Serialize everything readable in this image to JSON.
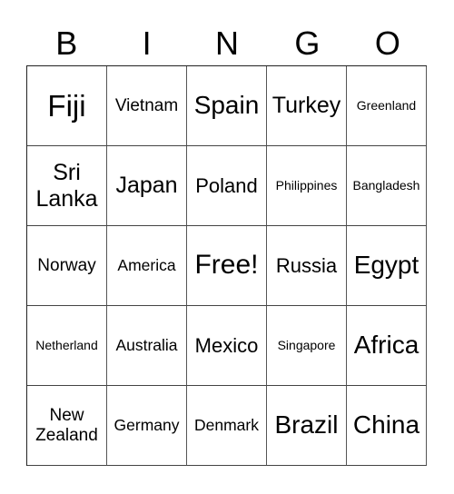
{
  "header": [
    "B",
    "I",
    "N",
    "G",
    "O"
  ],
  "cells": [
    [
      "Fiji",
      "Vietnam",
      "Spain",
      "Turkey",
      "Greenland"
    ],
    [
      "Sri Lanka",
      "Japan",
      "Poland",
      "Philippines",
      "Bangladesh"
    ],
    [
      "Norway",
      "America",
      "Free!",
      "Russia",
      "Egypt"
    ],
    [
      "Netherland",
      "Australia",
      "Mexico",
      "Singapore",
      "Africa"
    ],
    [
      "New Zealand",
      "Germany",
      "Denmark",
      "Brazil",
      "China"
    ]
  ]
}
